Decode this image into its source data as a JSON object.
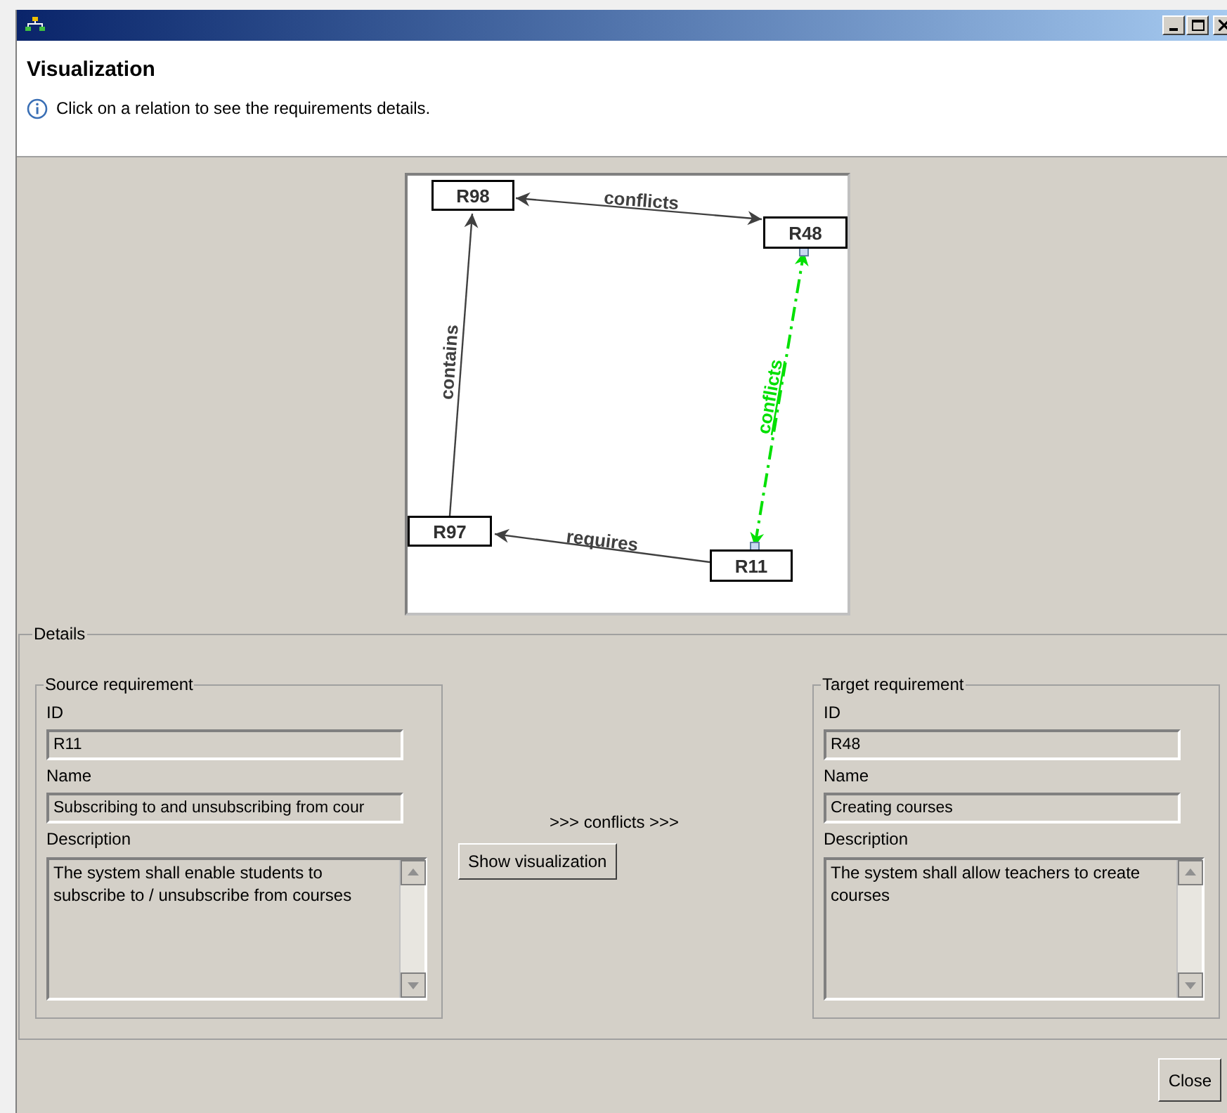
{
  "header": {
    "title": "Visualization",
    "message": "Click on a relation to see the requirements details."
  },
  "diagram": {
    "nodes": [
      {
        "label": "R98"
      },
      {
        "label": "R48"
      },
      {
        "label": "R97"
      },
      {
        "label": "R11"
      }
    ],
    "edges": [
      {
        "label": "conflicts",
        "bidirectional": true,
        "selected": false
      },
      {
        "label": "contains",
        "bidirectional": false,
        "selected": false
      },
      {
        "label": "requires",
        "bidirectional": false,
        "selected": false
      },
      {
        "label": "conflicts",
        "bidirectional": true,
        "selected": true
      }
    ]
  },
  "details": {
    "legend": "Details",
    "source": {
      "legend": "Source requirement",
      "id_label": "ID",
      "id": "R11",
      "name_label": "Name",
      "name": "Subscribing to and unsubscribing from cour",
      "description_label": "Description",
      "description": "The system shall enable students to subscribe to / unsubscribe from courses"
    },
    "relation": ">>> conflicts >>>",
    "show_button": "Show visualization",
    "target": {
      "legend": "Target requirement",
      "id_label": "ID",
      "id": "R48",
      "name_label": "Name",
      "name": "Creating courses",
      "description_label": "Description",
      "description": "The system shall allow teachers to create courses"
    }
  },
  "buttons": [
    "Close"
  ]
}
